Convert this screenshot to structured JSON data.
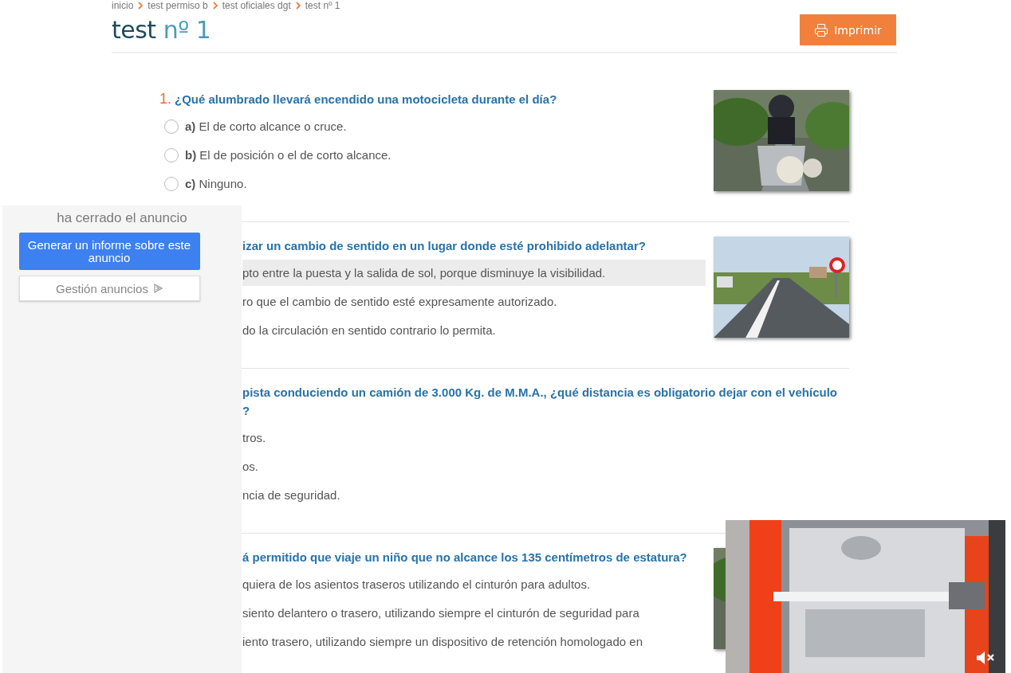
{
  "breadcrumb": [
    {
      "label": "inicio"
    },
    {
      "label": "test permiso b"
    },
    {
      "label": "test oficiales dgt"
    },
    {
      "label": "test nº 1"
    }
  ],
  "title": {
    "main": "test",
    "number": "nº 1"
  },
  "print_button": "Imprimir",
  "questions": [
    {
      "number": "1.",
      "lines": [
        "¿Qué alumbrado llevará encendido una motocicleta durante el día?"
      ],
      "answers": [
        {
          "letter": "a)",
          "text": "El de corto alcance o cruce.",
          "selected": false,
          "highlighted": false
        },
        {
          "letter": "b)",
          "text": "El de posición o el de corto alcance.",
          "selected": false,
          "highlighted": false
        },
        {
          "letter": "c)",
          "text": "Ninguno.",
          "selected": false,
          "highlighted": false
        }
      ],
      "image": {
        "kind": "picture"
      }
    },
    {
      "lines": [
        "izar un cambio de sentido en un lugar donde esté prohibido adelantar?"
      ],
      "answers": [
        {
          "text": "pto entre la puesta y la salida de sol, porque disminuye la visibilidad.",
          "highlighted": true
        },
        {
          "text": "ro que el cambio de sentido esté expresamente autorizado.",
          "highlighted": false
        },
        {
          "text": "do la circulación en sentido contrario lo permita.",
          "highlighted": false
        }
      ],
      "image": {
        "kind": "picture"
      }
    },
    {
      "lines": [
        "pista conduciendo un camión de 3.000 Kg. de M.M.A., ¿qué distancia es obligatorio dejar con el vehículo",
        "?"
      ],
      "answers": [
        {
          "text": "tros.",
          "highlighted": false
        },
        {
          "text": "os.",
          "highlighted": false
        },
        {
          "text": "ncia de seguridad.",
          "highlighted": false
        }
      ]
    },
    {
      "lines": [
        "á permitido que viaje un niño que no alcance los 135 centímetros de estatura?"
      ],
      "answers": [
        {
          "text": "quiera de los asientos traseros utilizando el cinturón para adultos.",
          "highlighted": false
        },
        {
          "text": "siento delantero o trasero, utilizando siempre el cinturón de seguridad para",
          "highlighted": false
        },
        {
          "text": "iento trasero, utilizando siempre un dispositivo de retención homologado en",
          "highlighted": false
        }
      ],
      "image": {
        "kind": "picture"
      }
    }
  ],
  "ad_panel": {
    "notice": "ha cerrado el anuncio",
    "report_button": "Generar un informe sobre este anuncio",
    "manage_button": "Gestión anuncios"
  },
  "video": {
    "kind": "picture",
    "muted": true
  }
}
